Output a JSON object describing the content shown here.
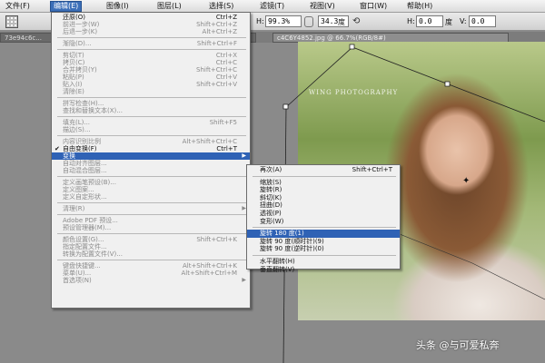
{
  "menubar": {
    "items": [
      {
        "label": "文件(F)",
        "active": false
      },
      {
        "label": "编辑(E)",
        "active": true
      },
      {
        "label": "图像(I)",
        "active": false
      },
      {
        "label": "图层(L)",
        "active": false
      },
      {
        "label": "选择(S)",
        "active": false
      },
      {
        "label": "滤镜(T)",
        "active": false
      },
      {
        "label": "视图(V)",
        "active": false
      },
      {
        "label": "窗口(W)",
        "active": false
      },
      {
        "label": "帮助(H)",
        "active": false
      }
    ]
  },
  "options": {
    "h_label": "H:",
    "h_value": "99.3%",
    "angle_value": "34.3",
    "angle_unit": "度",
    "hskew_label": "H:",
    "hskew_value": "0.0",
    "hskew_unit": "度",
    "vskew_label": "V:",
    "vskew_value": "0.0"
  },
  "tabs": [
    {
      "label": "73e94c6c..."
    },
    {
      "label": "c4C6Y4852.jpg @ 66.7%(RGB/8#)"
    }
  ],
  "photo": {
    "caption": "WING PHOTOGRAPHY"
  },
  "edit_menu": {
    "rows": [
      {
        "type": "item",
        "label": "还原(O)",
        "shortcut": "Ctrl+Z",
        "disabled": false
      },
      {
        "type": "item",
        "label": "前进一步(W)",
        "shortcut": "Shift+Ctrl+Z",
        "disabled": true
      },
      {
        "type": "item",
        "label": "后退一步(K)",
        "shortcut": "Alt+Ctrl+Z",
        "disabled": true
      },
      {
        "type": "sep"
      },
      {
        "type": "item",
        "label": "渐隐(D)...",
        "shortcut": "Shift+Ctrl+F",
        "disabled": true
      },
      {
        "type": "sep"
      },
      {
        "type": "item",
        "label": "剪切(T)",
        "shortcut": "Ctrl+X",
        "disabled": true
      },
      {
        "type": "item",
        "label": "拷贝(C)",
        "shortcut": "Ctrl+C",
        "disabled": true
      },
      {
        "type": "item",
        "label": "合并拷贝(Y)",
        "shortcut": "Shift+Ctrl+C",
        "disabled": true
      },
      {
        "type": "item",
        "label": "粘贴(P)",
        "shortcut": "Ctrl+V",
        "disabled": true
      },
      {
        "type": "item",
        "label": "贴入(I)",
        "shortcut": "Shift+Ctrl+V",
        "disabled": true
      },
      {
        "type": "item",
        "label": "清除(E)",
        "shortcut": "",
        "disabled": true
      },
      {
        "type": "sep"
      },
      {
        "type": "item",
        "label": "拼写检查(H)...",
        "shortcut": "",
        "disabled": true
      },
      {
        "type": "item",
        "label": "查找和替换文本(X)...",
        "shortcut": "",
        "disabled": true
      },
      {
        "type": "sep"
      },
      {
        "type": "item",
        "label": "填充(L)...",
        "shortcut": "Shift+F5",
        "disabled": true
      },
      {
        "type": "item",
        "label": "描边(S)...",
        "shortcut": "",
        "disabled": true
      },
      {
        "type": "sep"
      },
      {
        "type": "item",
        "label": "内容识别比例",
        "shortcut": "Alt+Shift+Ctrl+C",
        "disabled": true
      },
      {
        "type": "item",
        "label": "自由变换(F)",
        "shortcut": "Ctrl+T",
        "disabled": false,
        "checked": true
      },
      {
        "type": "item",
        "label": "变换",
        "shortcut": "",
        "disabled": false,
        "highlight": true,
        "submenu": true
      },
      {
        "type": "item",
        "label": "自动对齐图层...",
        "shortcut": "",
        "disabled": true
      },
      {
        "type": "item",
        "label": "自动混合图层...",
        "shortcut": "",
        "disabled": true
      },
      {
        "type": "sep"
      },
      {
        "type": "item",
        "label": "定义画笔预设(B)...",
        "shortcut": "",
        "disabled": true
      },
      {
        "type": "item",
        "label": "定义图案...",
        "shortcut": "",
        "disabled": true
      },
      {
        "type": "item",
        "label": "定义自定形状...",
        "shortcut": "",
        "disabled": true
      },
      {
        "type": "sep"
      },
      {
        "type": "item",
        "label": "清理(R)",
        "shortcut": "",
        "disabled": true,
        "submenu": true
      },
      {
        "type": "sep"
      },
      {
        "type": "item",
        "label": "Adobe PDF 预设...",
        "shortcut": "",
        "disabled": true
      },
      {
        "type": "item",
        "label": "预设管理器(M)...",
        "shortcut": "",
        "disabled": true
      },
      {
        "type": "sep"
      },
      {
        "type": "item",
        "label": "颜色设置(G)...",
        "shortcut": "Shift+Ctrl+K",
        "disabled": true
      },
      {
        "type": "item",
        "label": "指定配置文件...",
        "shortcut": "",
        "disabled": true
      },
      {
        "type": "item",
        "label": "转换为配置文件(V)...",
        "shortcut": "",
        "disabled": true
      },
      {
        "type": "sep"
      },
      {
        "type": "item",
        "label": "键盘快捷键...",
        "shortcut": "Alt+Shift+Ctrl+K",
        "disabled": true
      },
      {
        "type": "item",
        "label": "菜单(U)...",
        "shortcut": "Alt+Shift+Ctrl+M",
        "disabled": true
      },
      {
        "type": "item",
        "label": "首选项(N)",
        "shortcut": "",
        "disabled": true,
        "submenu": true
      }
    ]
  },
  "transform_submenu": {
    "rows": [
      {
        "type": "item",
        "label": "再次(A)",
        "shortcut": "Shift+Ctrl+T"
      },
      {
        "type": "sep"
      },
      {
        "type": "item",
        "label": "缩放(S)",
        "shortcut": ""
      },
      {
        "type": "item",
        "label": "旋转(R)",
        "shortcut": ""
      },
      {
        "type": "item",
        "label": "斜切(K)",
        "shortcut": ""
      },
      {
        "type": "item",
        "label": "扭曲(D)",
        "shortcut": ""
      },
      {
        "type": "item",
        "label": "透视(P)",
        "shortcut": ""
      },
      {
        "type": "item",
        "label": "变形(W)",
        "shortcut": ""
      },
      {
        "type": "sep"
      },
      {
        "type": "item",
        "label": "旋转 180 度(1)",
        "shortcut": "",
        "highlight": true
      },
      {
        "type": "item",
        "label": "旋转 90 度(顺时针)(9)",
        "shortcut": ""
      },
      {
        "type": "item",
        "label": "旋转 90 度(逆时针)(0)",
        "shortcut": ""
      },
      {
        "type": "sep"
      },
      {
        "type": "item",
        "label": "水平翻转(H)",
        "shortcut": ""
      },
      {
        "type": "item",
        "label": "垂直翻转(V)",
        "shortcut": ""
      }
    ]
  },
  "watermark": "头条 @与可爱私奔"
}
